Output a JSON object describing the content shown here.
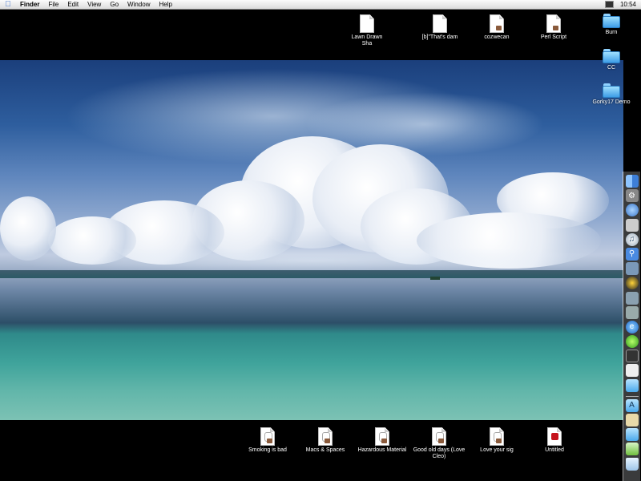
{
  "menubar": {
    "apple_icon": "apple-icon",
    "menus": [
      "Finder",
      "File",
      "Edit",
      "View",
      "Go",
      "Window",
      "Help"
    ],
    "clock": "10:54",
    "display_icon": "monitor-icon"
  },
  "desktop": {
    "top_items": [
      {
        "label": "Lawn Drawn  Sha",
        "icon": "text-document-icon"
      },
      {
        "label": "[b]\"That's dam",
        "icon": "text-document-icon"
      },
      {
        "label": "cozwecan",
        "icon": "script-document-icon"
      },
      {
        "label": "Perl Script",
        "icon": "script-document-icon"
      }
    ],
    "right_items": [
      {
        "label": "Burn",
        "icon": "folder-icon"
      },
      {
        "label": "CC",
        "icon": "folder-icon"
      },
      {
        "label": "Gorky17 Demo",
        "icon": "folder-icon"
      }
    ],
    "bottom_items": [
      {
        "label": "Smoking is bad",
        "icon": "clipping-document-icon"
      },
      {
        "label": "Macs & Spaces",
        "icon": "clipping-document-icon"
      },
      {
        "label": "Hazardous Material",
        "icon": "clipping-document-icon"
      },
      {
        "label": "Good old days (Love Cleo)",
        "icon": "clipping-document-icon"
      },
      {
        "label": "Love your sig",
        "icon": "clipping-document-icon"
      },
      {
        "label": "Untitled",
        "icon": "pdf-document-icon"
      }
    ]
  },
  "dock": {
    "apps": [
      "finder-icon",
      "system-preferences-icon",
      "mail-icon",
      "text-edit-icon",
      "itunes-icon",
      "sherlock-icon",
      "preview-icon",
      "quicktime-icon",
      "photo-icon",
      "address-book-icon",
      "internet-explorer-icon",
      "limewire-icon",
      "terminal-icon",
      "stickies-icon",
      "folder-icon"
    ],
    "docklets": [
      "applications-icon",
      "documents-icon",
      "folder-icon",
      "clipping-icon",
      "trash-icon"
    ]
  },
  "colors": {
    "folder_blue": "#4aa8ec",
    "dock_bg": "#d0d8e0",
    "menubar_bg": "#f2f2f2"
  }
}
